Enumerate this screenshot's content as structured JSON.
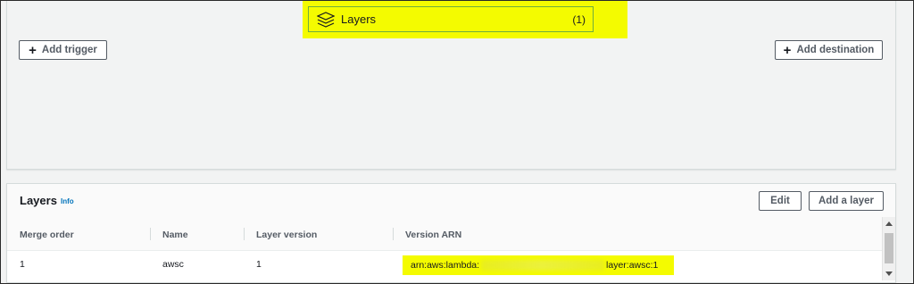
{
  "designer": {
    "layers_node": {
      "label": "Layers",
      "count": "(1)",
      "icon": "layers-icon"
    },
    "add_trigger_label": "Add trigger",
    "add_destination_label": "Add destination",
    "plus_icon": "plus-icon"
  },
  "layers_panel": {
    "title": "Layers",
    "info_label": "Info",
    "edit_label": "Edit",
    "add_layer_label": "Add a layer",
    "columns": [
      "Merge order",
      "Name",
      "Layer version",
      "Version ARN"
    ],
    "rows": [
      {
        "merge_order": "1",
        "name": "awsc",
        "layer_version": "1",
        "arn_prefix": "arn:aws:lambda:",
        "arn_suffix": "layer:awsc:1"
      }
    ]
  },
  "colors": {
    "highlight": "#f4fb00",
    "link": "#0073bb",
    "node_border": "#6fae3f"
  }
}
